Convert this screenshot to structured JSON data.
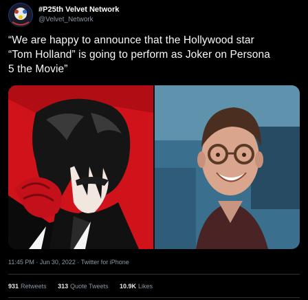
{
  "author": {
    "display_name": "#P25th Velvet Network",
    "handle": "@Velvet_Network"
  },
  "tweet": {
    "line1": "“We are happy to announce that the Hollywood star",
    "line2": "“Tom Holland” is going to perform as Joker on Persona",
    "line3": "5 the Movie”"
  },
  "meta": {
    "timestamp": "11:45 PM · Jun 30, 2022 · Twitter for iPhone"
  },
  "stats": {
    "retweets_num": "931",
    "retweets_label": "Retweets",
    "quotes_num": "313",
    "quotes_label": "Quote Tweets",
    "likes_num": "10.9K",
    "likes_label": "Likes"
  },
  "colors": {
    "background": "#000000",
    "text": "#e7e9ea",
    "secondary": "#8b98a5",
    "divider": "#2f3336",
    "persona_red": "#d0121b"
  }
}
